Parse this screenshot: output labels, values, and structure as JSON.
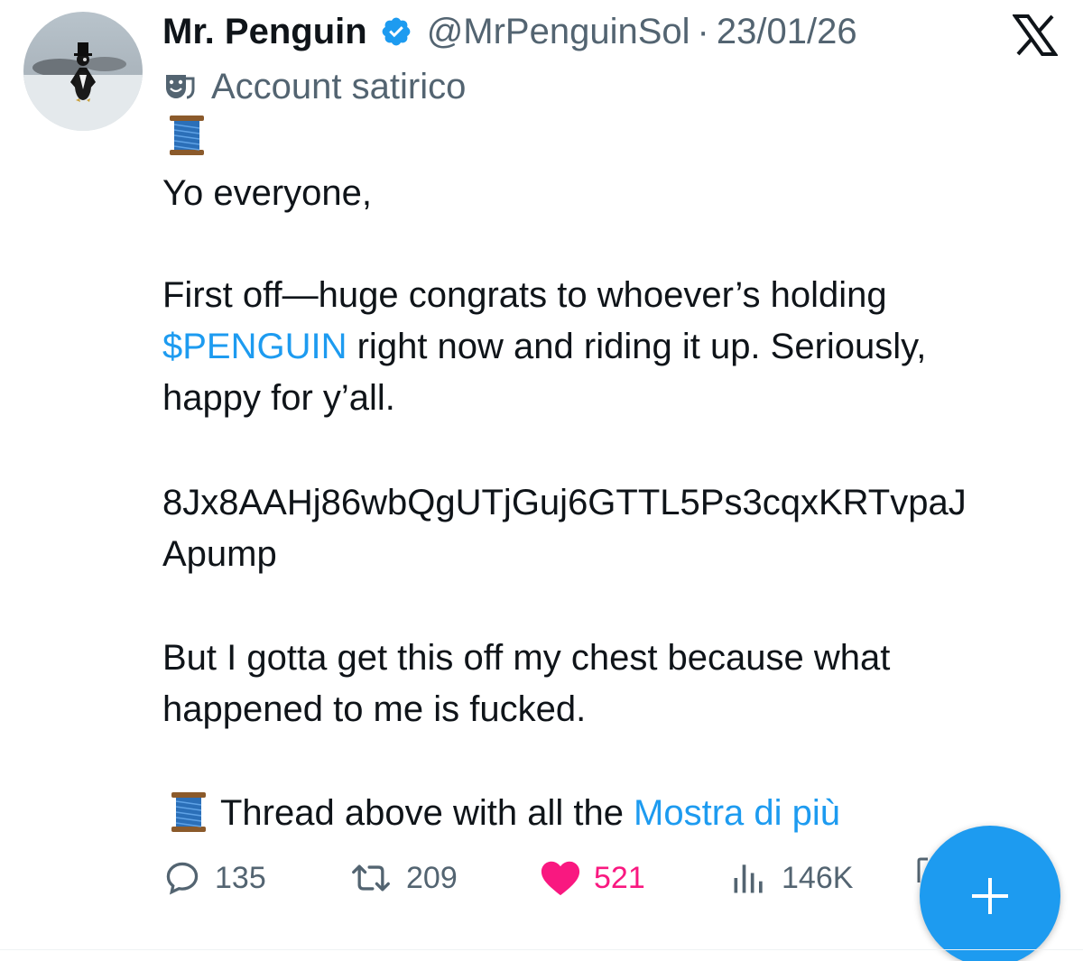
{
  "author": {
    "name": "Mr. Penguin",
    "handle": "@MrPenguinSol",
    "separator": "·",
    "date": "23/01/26",
    "label": "Account satirico"
  },
  "tweet": {
    "line1": "Yo everyone,",
    "para2_line1": "First off—huge congrats to whoever’s holding",
    "para2_ticker": "$PENGUIN",
    "para2_line2_rest": " right now and riding it up. Seriously,",
    "para2_line3": "happy for y’all.",
    "address_line1": "8Jx8AAHj86wbQgUTjGuj6GTTL5Ps3cqxKRTvpaJ",
    "address_line2": "Apump",
    "para4_line1": "But I gotta get this off my chest because what",
    "para4_line2": "happened to me is fucked.",
    "thread_text": "Thread above with all the ",
    "show_more": "Mostra di più"
  },
  "actions": {
    "replies": "135",
    "reposts": "209",
    "likes": "521",
    "views": "146K"
  },
  "icons": {
    "verified": "verified-badge-icon",
    "x_logo": "x-logo-icon",
    "label": "theater-masks-icon",
    "spool": "thread-spool-icon",
    "reply": "reply-icon",
    "repost": "repost-icon",
    "like": "heart-icon",
    "views": "views-icon",
    "compose": "plus-icon"
  },
  "colors": {
    "accent": "#1d9bf0",
    "like": "#f91880",
    "secondary_text": "#536471",
    "primary_text": "#0f1419"
  }
}
